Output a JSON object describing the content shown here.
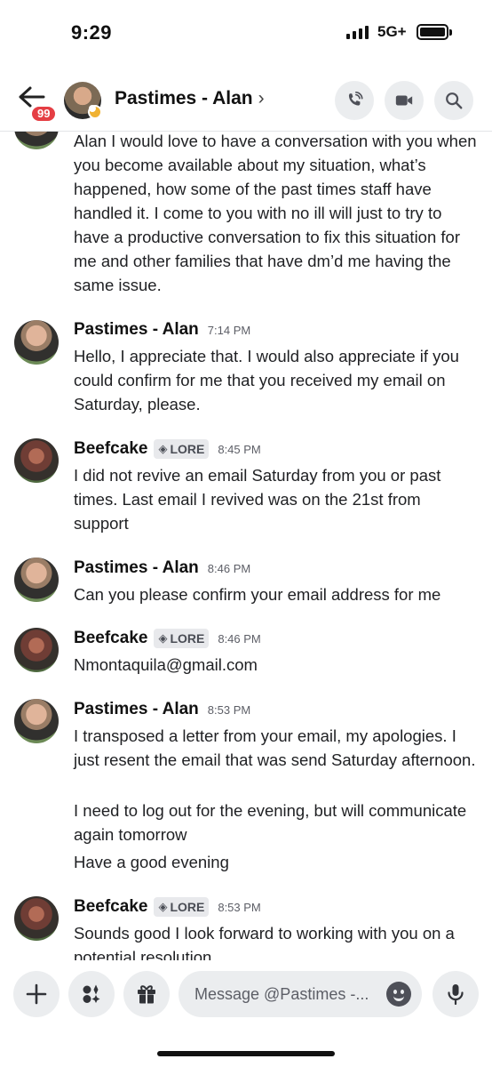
{
  "status_bar": {
    "time": "9:29",
    "network": "5G+"
  },
  "header": {
    "unread_badge": "99",
    "title": "Pastimes - Alan",
    "chevron": "›"
  },
  "icons": {
    "back": "arrow-left-icon",
    "call": "phone-icon",
    "video": "video-camera-icon",
    "search": "search-icon",
    "add": "plus-icon",
    "apps": "apps-icon",
    "gift": "gift-icon",
    "emoji": "emoji-icon",
    "mic": "microphone-icon"
  },
  "messages": [
    {
      "lines": [
        "Alan I would love to have a conversation with you when you become available about my situation, what’s happened, how some of the past times staff have handled it. I come to you with no ill will just to try to have a productive conversation to fix this situation for me and other families that have dm’d me having the same issue."
      ]
    },
    {
      "author": "Pastimes - Alan",
      "time": "7:14 PM",
      "lines": [
        "Hello, I appreciate that. I would also appreciate if you could confirm for me that you received my email on Saturday, please."
      ]
    },
    {
      "author": "Beefcake",
      "tag": "LORE",
      "time": "8:45 PM",
      "lines": [
        "I did not revive an email Saturday from you or past times. Last email I revived was on the 21st from support"
      ]
    },
    {
      "author": "Pastimes - Alan",
      "time": "8:46 PM",
      "lines": [
        "Can you please confirm your email address for me"
      ]
    },
    {
      "author": "Beefcake",
      "tag": "LORE",
      "time": "8:46 PM",
      "lines": [
        "Nmontaquila@gmail.com"
      ]
    },
    {
      "author": "Pastimes - Alan",
      "time": "8:53 PM",
      "lines": [
        "I transposed a letter from your email, my apologies. I just resent the email that was send Saturday afternoon.",
        "I need to log out for the evening, but will communicate again tomorrow",
        "Have a good evening"
      ]
    },
    {
      "author": "Beefcake",
      "tag": "LORE",
      "time": "8:53 PM",
      "lines": [
        "Sounds good I look forward to working with you on a potential resolution"
      ]
    }
  ],
  "composer": {
    "placeholder": "Message @Pastimes -..."
  },
  "colors": {
    "badge": "#e53e44",
    "idle_status": "#f0b232",
    "button_bg": "#ebedef"
  }
}
